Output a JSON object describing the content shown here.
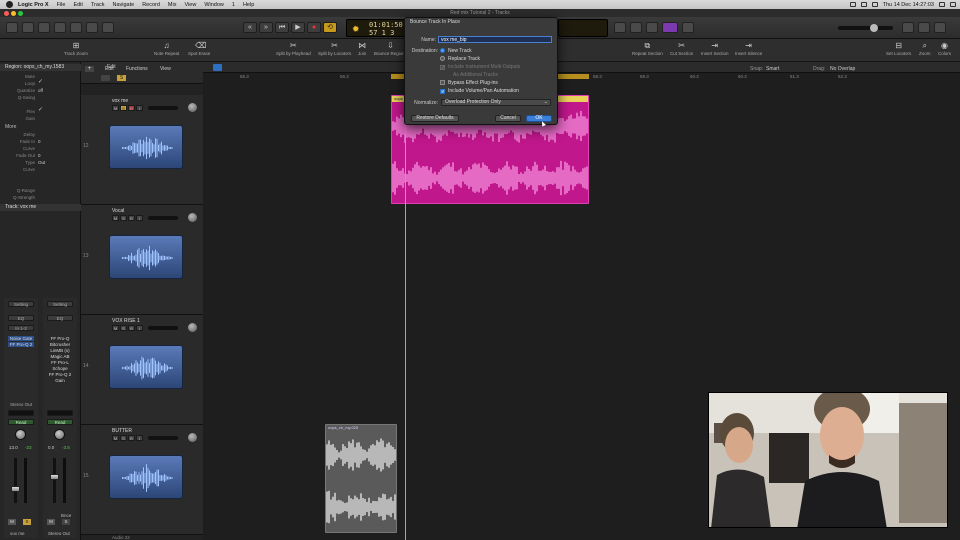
{
  "menubar": {
    "app_name": "Logic Pro X",
    "items": [
      "File",
      "Edit",
      "Track",
      "Navigate",
      "Record",
      "Mix",
      "View",
      "Window",
      "1",
      "Help"
    ],
    "clock": "Thu 14 Dec 14:27:03"
  },
  "window": {
    "title": "Red mix Tutorial 2 - Tracks"
  },
  "lcd": {
    "time": "01:01:50:1",
    "beats": "57 1 3"
  },
  "toolbar": {
    "tools": [
      {
        "label": "Track Zoom",
        "icon": "track-zoom-icon"
      },
      {
        "label": "Note Repeat",
        "icon": "note-repeat-icon"
      },
      {
        "label": "Spot Erase",
        "icon": "spot-erase-icon"
      },
      {
        "label": "Split by Playhead",
        "icon": "scissors-icon"
      },
      {
        "label": "Split by Locators",
        "icon": "scissors-icon"
      },
      {
        "label": "Join",
        "icon": "join-icon"
      },
      {
        "label": "Bounce Regions",
        "icon": "bounce-icon"
      },
      {
        "label": "Repeat Section",
        "icon": "repeat-section-icon"
      },
      {
        "label": "Cut Section",
        "icon": "cut-section-icon"
      },
      {
        "label": "Insert Section",
        "icon": "insert-section-icon"
      },
      {
        "label": "Insert Silence",
        "icon": "insert-silence-icon"
      },
      {
        "label": "Set Locators",
        "icon": "set-locators-icon"
      },
      {
        "label": "Zoom",
        "icon": "zoom-icon"
      },
      {
        "label": "Colors",
        "icon": "colors-icon"
      }
    ]
  },
  "inspector": {
    "region_header": "Region: oops_ch_my.1583",
    "params": [
      {
        "k": "Mute",
        "v": ""
      },
      {
        "k": "Loop",
        "v": "✓"
      },
      {
        "k": "Quantize",
        "v": "off"
      },
      {
        "k": "Q-Swing",
        "v": ""
      },
      {
        "k": "Flex",
        "v": "✓"
      },
      {
        "k": "Gain",
        "v": ""
      }
    ],
    "more_header": "More",
    "more_params": [
      {
        "k": "Delay",
        "v": ""
      },
      {
        "k": "Fade In",
        "v": "0"
      },
      {
        "k": "Curve",
        "v": ""
      },
      {
        "k": "Fade Out",
        "v": "0"
      },
      {
        "k": "Type",
        "v": "Out"
      },
      {
        "k": "Curve",
        "v": ""
      }
    ],
    "extra_params": [
      {
        "k": "Q-Range",
        "v": ""
      },
      {
        "k": "Q-Strength",
        "v": ""
      }
    ],
    "track_header": "Track: vox me"
  },
  "strips": [
    {
      "setting": "Setting",
      "eq": "EQ",
      "input": "In 1-2",
      "plugins": [
        "Noise Gate",
        "FF Pro-Q 2"
      ],
      "output": "Stereo Out",
      "automation": "Read",
      "vol": "13.0",
      "peak": "-23",
      "name": "vox me"
    },
    {
      "setting": "Setting",
      "eq": "EQ",
      "input": "",
      "plugins": [
        "FF Pro-Q",
        "Bitcrusher",
        "LinMB (s)",
        "Magic AB",
        "FF Pro-L",
        "Schope",
        "FF Pro-Q 2",
        "Gain"
      ],
      "output": "",
      "automation": "Read",
      "vol": "0.0",
      "peak": "-3.5",
      "name": "Stereo Out",
      "extra": "Bnce"
    }
  ],
  "track_subbar": {
    "edit": "Edit",
    "functions": "Functions",
    "view": "View",
    "snap_label": "Snap:",
    "snap": "Smart",
    "drag_label": "Drag:",
    "drag": "No Overlap"
  },
  "ruler": [
    "55.3",
    "56.3",
    "58.3",
    "59.3",
    "60.3",
    "60.3",
    "61.3",
    "62.3"
  ],
  "tracks": [
    {
      "num": "12",
      "name": "vox me"
    },
    {
      "num": "13",
      "name": "Vocal"
    },
    {
      "num": "14",
      "name": "VOX RISE 1"
    },
    {
      "num": "15",
      "name": "BUTTER"
    }
  ],
  "regions": {
    "main": "oops",
    "butter": "oops_ch_my.025"
  },
  "track_footer": "Audio 22",
  "dialog": {
    "title": "Bounce Track In Place",
    "name_label": "Name:",
    "name_value": "vox me_bip",
    "destination_label": "Destination:",
    "new_track": "New Track",
    "replace_track": "Replace Track",
    "include_multi": "Include Instrument Multi-Outputs",
    "as_additional": "As Additional Tracks",
    "bypass_effects": "Bypass Effect Plug-ins",
    "include_automation": "Include Volume/Pan Automation",
    "normalize_label": "Normalize:",
    "normalize_value": "Overload Protection Only",
    "restore": "Restore Defaults",
    "cancel": "Cancel",
    "ok": "OK"
  },
  "colors": {
    "region_magenta": "#c0178c",
    "accent_blue": "#3b7fd8",
    "lcd_text": "#e8d9a0",
    "region_gray": "#9a9a9a",
    "icon_blue": "#4d6fae"
  }
}
